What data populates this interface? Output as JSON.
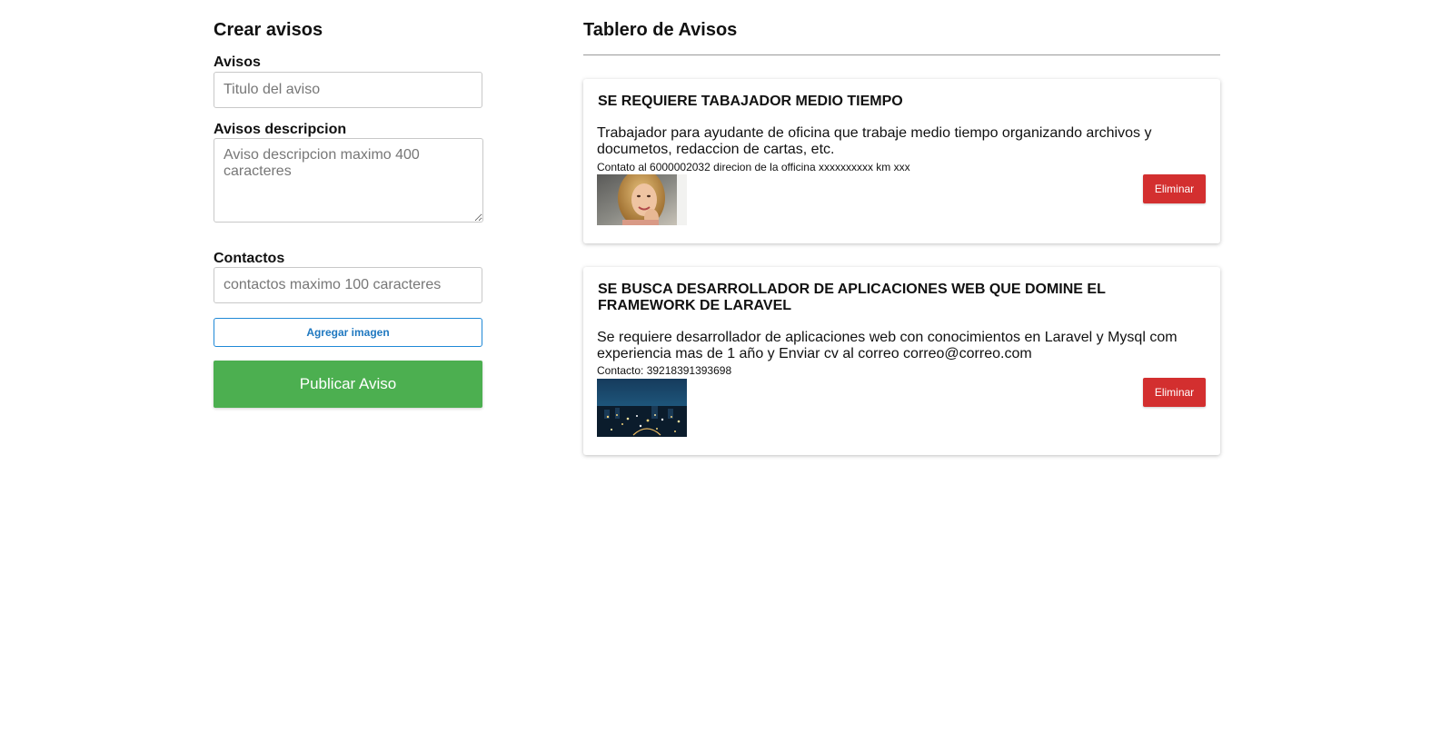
{
  "form": {
    "title": "Crear avisos",
    "title_label": "Avisos",
    "title_placeholder": "Titulo del aviso",
    "description_label": "Avisos descripcion",
    "description_placeholder": "Aviso descripcion maximo 400 caracteres",
    "contacts_label": "Contactos",
    "contacts_placeholder": "contactos maximo 100 caracteres",
    "add_image_label": "Agregar imagen",
    "publish_label": "Publicar Aviso"
  },
  "board": {
    "title": "Tablero de Avisos",
    "cards": [
      {
        "title": "SE REQUIERE TABAJADOR MEDIO TIEMPO",
        "description": "Trabajador para ayudante de oficina que trabaje medio tiempo organizando archivos y documetos, redaccion de cartas, etc.",
        "contact": "Contato al 6000002032 direcion de la officina xxxxxxxxxx km xxx",
        "image": "woman-portrait-photo",
        "delete_label": "Eliminar"
      },
      {
        "title": "SE BUSCA DESARROLLADOR DE APLICACIONES WEB QUE DOMINE EL FRAMEWORK DE LARAVEL",
        "description": "Se requiere desarrollador de aplicaciones web con conocimientos en Laravel y Mysql com experiencia mas de 1 año y Enviar cv al correo correo@correo.com",
        "contact": "Contacto: 39218391393698",
        "image": "night-city-photo",
        "delete_label": "Eliminar"
      }
    ]
  },
  "colors": {
    "publish": "#4caf50",
    "delete": "#d32f2f",
    "add_image_border": "#1f88d6"
  }
}
